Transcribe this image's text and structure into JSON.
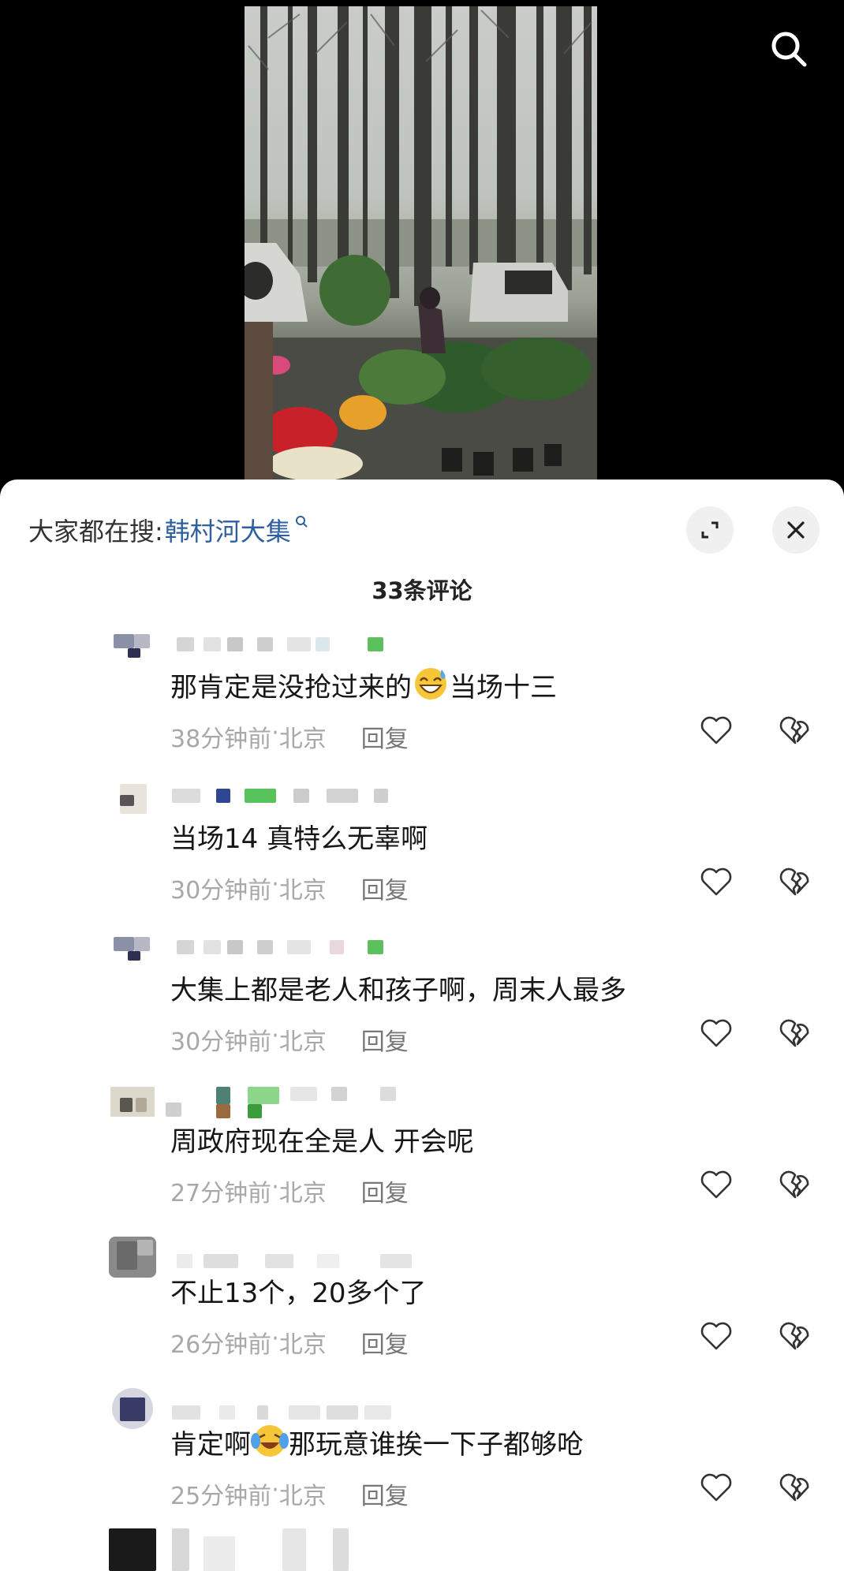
{
  "hot_search": {
    "prefix": "大家都在搜:",
    "term": "韩村河大集"
  },
  "comment_count": "33条评论",
  "comments": [
    {
      "text_before": "那肯定是没抢过来的",
      "emoji": "grinning-sweat-emoji",
      "text_after": "当场十三",
      "time": "38分钟前",
      "location": "北京",
      "reply": "回复"
    },
    {
      "text_before": "当场14 真特么无辜啊",
      "emoji": "",
      "text_after": "",
      "time": "30分钟前",
      "location": "北京",
      "reply": "回复"
    },
    {
      "text_before": "大集上都是老人和孩子啊，周末人最多",
      "emoji": "",
      "text_after": "",
      "time": "30分钟前",
      "location": "北京",
      "reply": "回复"
    },
    {
      "text_before": "周政府现在全是人 开会呢",
      "emoji": "",
      "text_after": "",
      "time": "27分钟前",
      "location": "北京",
      "reply": "回复"
    },
    {
      "text_before": "不止13个，20多个了",
      "emoji": "",
      "text_after": "",
      "time": "26分钟前",
      "location": "北京",
      "reply": "回复"
    },
    {
      "text_before": "肯定啊",
      "emoji": "crying-laughing-emoji",
      "text_after": "那玩意谁挨一下子都够呛",
      "time": "25分钟前",
      "location": "北京",
      "reply": "回复"
    }
  ],
  "meta_separator": " · ",
  "icons": {
    "search": "search-icon",
    "expand": "expand-icon",
    "close": "close-icon",
    "like": "heart-icon",
    "dislike": "broken-heart-icon"
  },
  "colors": {
    "link": "#2f5f9e",
    "meta": "#a8a8a8",
    "text": "#161616"
  }
}
